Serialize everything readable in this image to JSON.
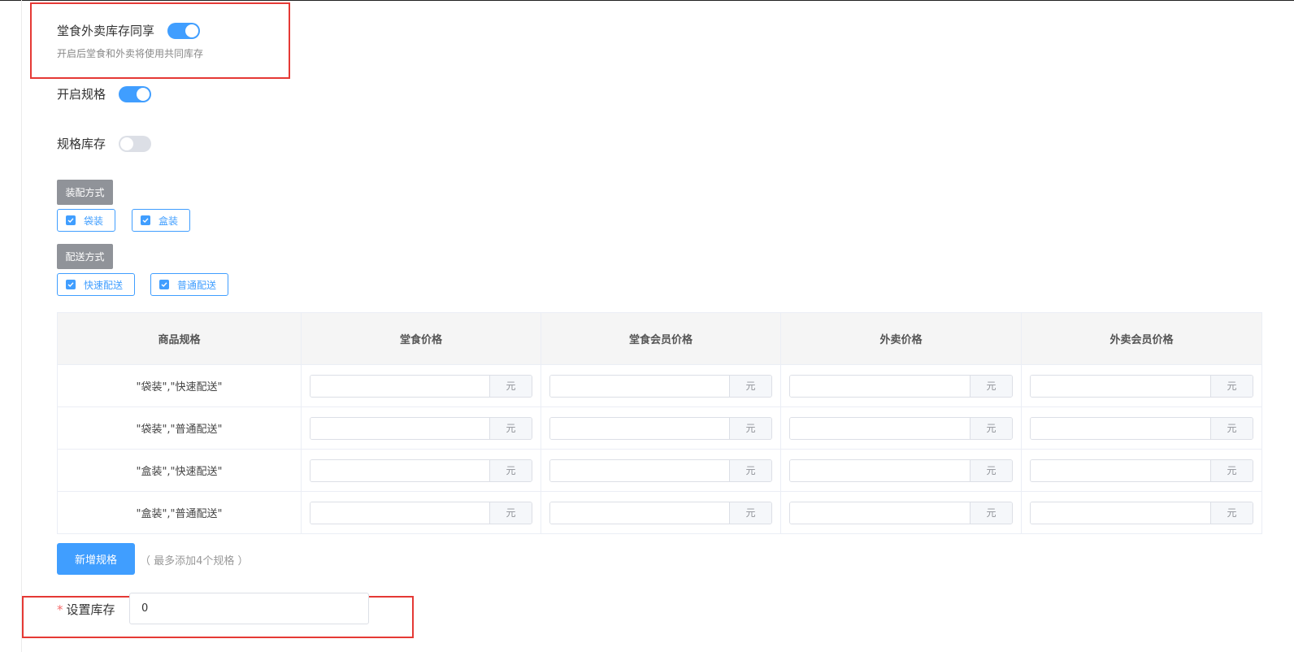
{
  "share_stock": {
    "label": "堂食外卖库存同享",
    "enabled": true,
    "hint": "开启后堂食和外卖将使用共同库存"
  },
  "enable_spec": {
    "label": "开启规格",
    "enabled": true
  },
  "spec_stock": {
    "label": "规格库存",
    "enabled": false
  },
  "groups": [
    {
      "title": "装配方式",
      "options": [
        {
          "label": "袋装",
          "checked": true
        },
        {
          "label": "盒装",
          "checked": true
        }
      ]
    },
    {
      "title": "配送方式",
      "options": [
        {
          "label": "快速配送",
          "checked": true
        },
        {
          "label": "普通配送",
          "checked": true
        }
      ]
    }
  ],
  "table": {
    "headers": [
      "商品规格",
      "堂食价格",
      "堂食会员价格",
      "外卖价格",
      "外卖会员价格"
    ],
    "unit": "元",
    "rows": [
      {
        "spec": "\"袋装\",\"快速配送\"",
        "prices": [
          "",
          "",
          "",
          ""
        ]
      },
      {
        "spec": "\"袋装\",\"普通配送\"",
        "prices": [
          "",
          "",
          "",
          ""
        ]
      },
      {
        "spec": "\"盒装\",\"快速配送\"",
        "prices": [
          "",
          "",
          "",
          ""
        ]
      },
      {
        "spec": "\"盒装\",\"普通配送\"",
        "prices": [
          "",
          "",
          "",
          ""
        ]
      }
    ]
  },
  "add_spec": {
    "label": "新增规格",
    "hint": "（ 最多添加4个规格 ）"
  },
  "stock": {
    "required_mark": "*",
    "label": "设置库存",
    "value": "0"
  }
}
